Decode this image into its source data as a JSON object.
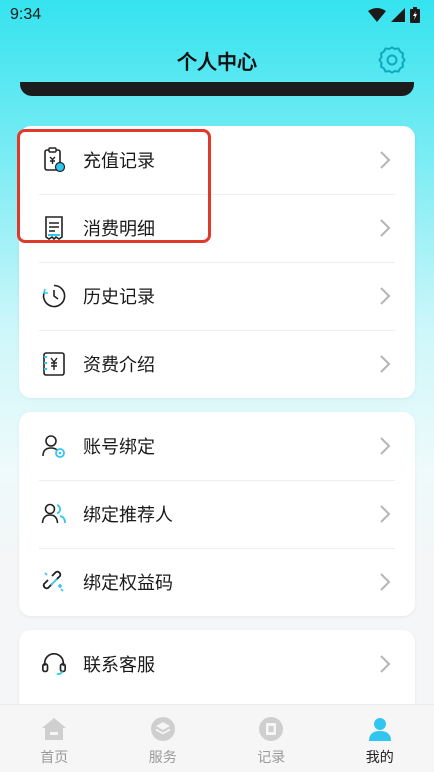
{
  "status_bar": {
    "time": "9:34"
  },
  "header": {
    "title": "个人中心"
  },
  "menu_groups": [
    {
      "items": [
        {
          "label": "充值记录",
          "icon": "recharge-record-icon"
        },
        {
          "label": "消费明细",
          "icon": "consumption-detail-icon"
        },
        {
          "label": "历史记录",
          "icon": "history-icon"
        },
        {
          "label": "资费介绍",
          "icon": "tariff-icon"
        }
      ]
    },
    {
      "items": [
        {
          "label": "账号绑定",
          "icon": "account-bind-icon"
        },
        {
          "label": "绑定推荐人",
          "icon": "referrer-icon"
        },
        {
          "label": "绑定权益码",
          "icon": "benefit-code-icon"
        }
      ]
    },
    {
      "items": [
        {
          "label": "联系客服",
          "icon": "headset-icon"
        }
      ]
    }
  ],
  "tab_bar": {
    "tabs": [
      {
        "label": "首页",
        "icon": "home-icon",
        "active": false
      },
      {
        "label": "服务",
        "icon": "service-icon",
        "active": false
      },
      {
        "label": "记录",
        "icon": "record-icon",
        "active": false
      },
      {
        "label": "我的",
        "icon": "profile-icon",
        "active": true
      }
    ]
  },
  "colors": {
    "accent": "#30c6ef",
    "highlight": "#e0392b",
    "inactive_tab": "#c8c8c8"
  }
}
